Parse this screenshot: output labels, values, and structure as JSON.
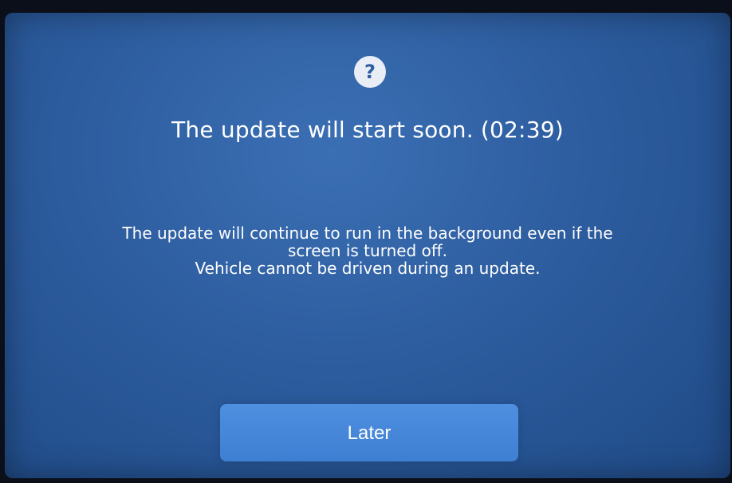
{
  "dialog": {
    "icon": "question-mark-icon",
    "icon_glyph": "?",
    "title": "The update will start soon. (02:39)",
    "message_lines": [
      "The update will continue to run in the background even if the",
      "screen is turned off.",
      "Vehicle cannot be driven during an update."
    ],
    "later_label": "Later"
  },
  "colors": {
    "background": "#2d5d9f",
    "button": "#4a89dc",
    "text": "#ffffff"
  }
}
